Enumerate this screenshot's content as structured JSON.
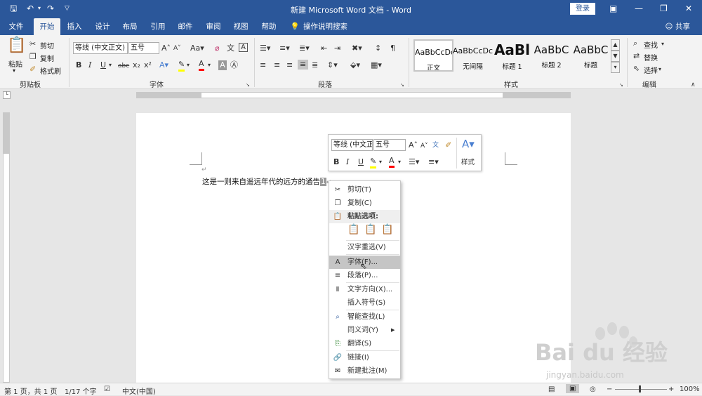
{
  "title": "新建 Microsoft Word 文档  -  Word",
  "login_label": "登录",
  "tabs": [
    "文件",
    "开始",
    "插入",
    "设计",
    "布局",
    "引用",
    "邮件",
    "审阅",
    "视图",
    "帮助"
  ],
  "tell_me": "操作说明搜索",
  "share": "共享",
  "clipboard": {
    "paste": "粘贴",
    "cut": "剪切",
    "copy": "复制",
    "painter": "格式刷",
    "group": "剪贴板"
  },
  "font": {
    "name": "等线 (中文正文)",
    "size": "五号",
    "group": "字体"
  },
  "paragraph": {
    "group": "段落"
  },
  "styles": {
    "items": [
      {
        "sample": "AaBbCcDc",
        "name": "正文"
      },
      {
        "sample": "AaBbCcDc",
        "name": "无间隔"
      },
      {
        "sample": "AaBl",
        "name": "标题 1"
      },
      {
        "sample": "AaBbC",
        "name": "标题 2"
      },
      {
        "sample": "AaBbC",
        "name": "标题"
      }
    ],
    "group": "样式"
  },
  "editing": {
    "find": "查找",
    "replace": "替换",
    "select": "选择",
    "group": "编辑"
  },
  "document": {
    "text": "这是一则来自遥远年代的远方的通告"
  },
  "mini_toolbar": {
    "font": "等线 (中文正文)",
    "size": "五号",
    "styles": "样式"
  },
  "context_menu": {
    "cut": "剪切(T)",
    "copy": "复制(C)",
    "paste_options": "粘贴选项:",
    "reconvert": "汉字重选(V)",
    "font": "字体(F)...",
    "paragraph": "段落(P)...",
    "text_direction": "文字方向(X)...",
    "insert_symbol": "插入符号(S)",
    "smart_lookup": "智能查找(L)",
    "synonyms": "同义词(Y)",
    "translate": "翻译(S)",
    "link": "链接(I)",
    "new_comment": "新建批注(M)"
  },
  "status": {
    "page": "第 1 页，共 1 页",
    "words": "1/17 个字",
    "language": "中文(中国)",
    "zoom": "100%"
  },
  "watermark": {
    "logo": "Bai du 经验",
    "url": "jingyan.baidu.com"
  },
  "colors": {
    "accent": "#2b579a",
    "highlight": "#ffff00",
    "font_color": "#ff0000"
  }
}
